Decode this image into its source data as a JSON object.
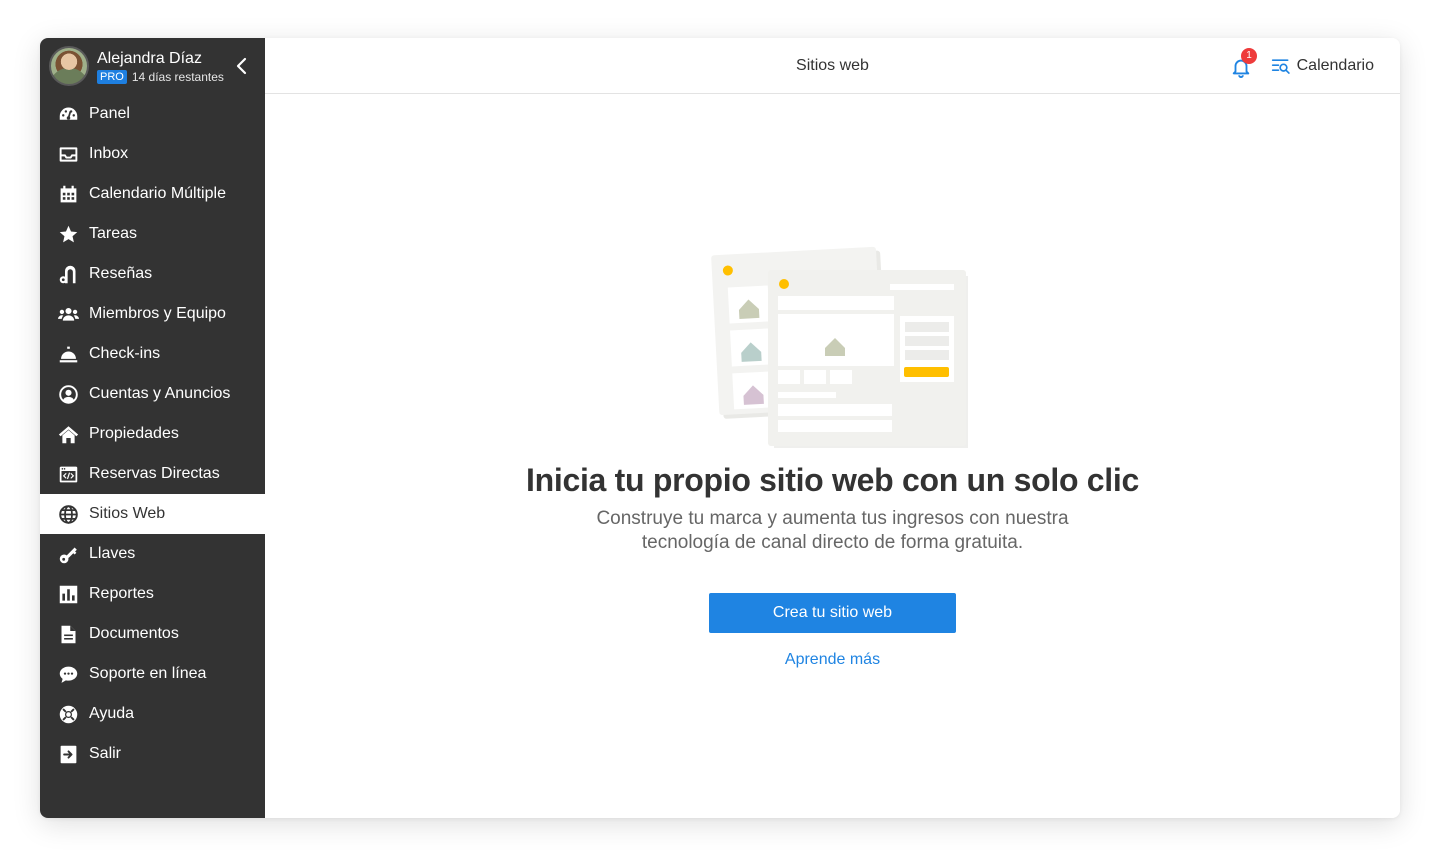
{
  "user": {
    "name": "Alejandra Díaz",
    "plan_badge": "PRO",
    "trial_text": "14 días restantes"
  },
  "sidebar": {
    "items": [
      {
        "label": "Panel",
        "icon": "dashboard-icon"
      },
      {
        "label": "Inbox",
        "icon": "inbox-icon"
      },
      {
        "label": "Calendario Múltiple",
        "icon": "calendar-icon"
      },
      {
        "label": "Tareas",
        "icon": "star-icon"
      },
      {
        "label": "Reseñas",
        "icon": "reviews-icon"
      },
      {
        "label": "Miembros y Equipo",
        "icon": "team-icon"
      },
      {
        "label": "Check-ins",
        "icon": "bell-service-icon"
      },
      {
        "label": "Cuentas y Anuncios",
        "icon": "account-icon"
      },
      {
        "label": "Propiedades",
        "icon": "home-icon"
      },
      {
        "label": "Reservas Directas",
        "icon": "code-window-icon"
      },
      {
        "label": "Sitios Web",
        "icon": "globe-icon",
        "active": true
      },
      {
        "label": "Llaves",
        "icon": "key-icon"
      },
      {
        "label": "Reportes",
        "icon": "reports-icon"
      },
      {
        "label": "Documentos",
        "icon": "document-icon"
      },
      {
        "label": "Soporte en línea",
        "icon": "chat-icon"
      },
      {
        "label": "Ayuda",
        "icon": "lifebuoy-icon"
      },
      {
        "label": "Salir",
        "icon": "logout-icon"
      }
    ]
  },
  "header": {
    "title": "Sitios web",
    "notification_count": "1",
    "calendar_label": "Calendario"
  },
  "hero": {
    "title": "Inicia tu propio sitio web con un solo clic",
    "subtitle": "Construye tu marca y aumenta tus ingresos con nuestra tecnología de canal directo de forma gratuita.",
    "cta_label": "Crea tu sitio web",
    "learn_more": "Aprende más"
  },
  "colors": {
    "sidebar_bg": "#333333",
    "accent": "#1f84e2",
    "badge_red": "#ee3b3b",
    "illustration_yellow": "#ffbf00"
  }
}
